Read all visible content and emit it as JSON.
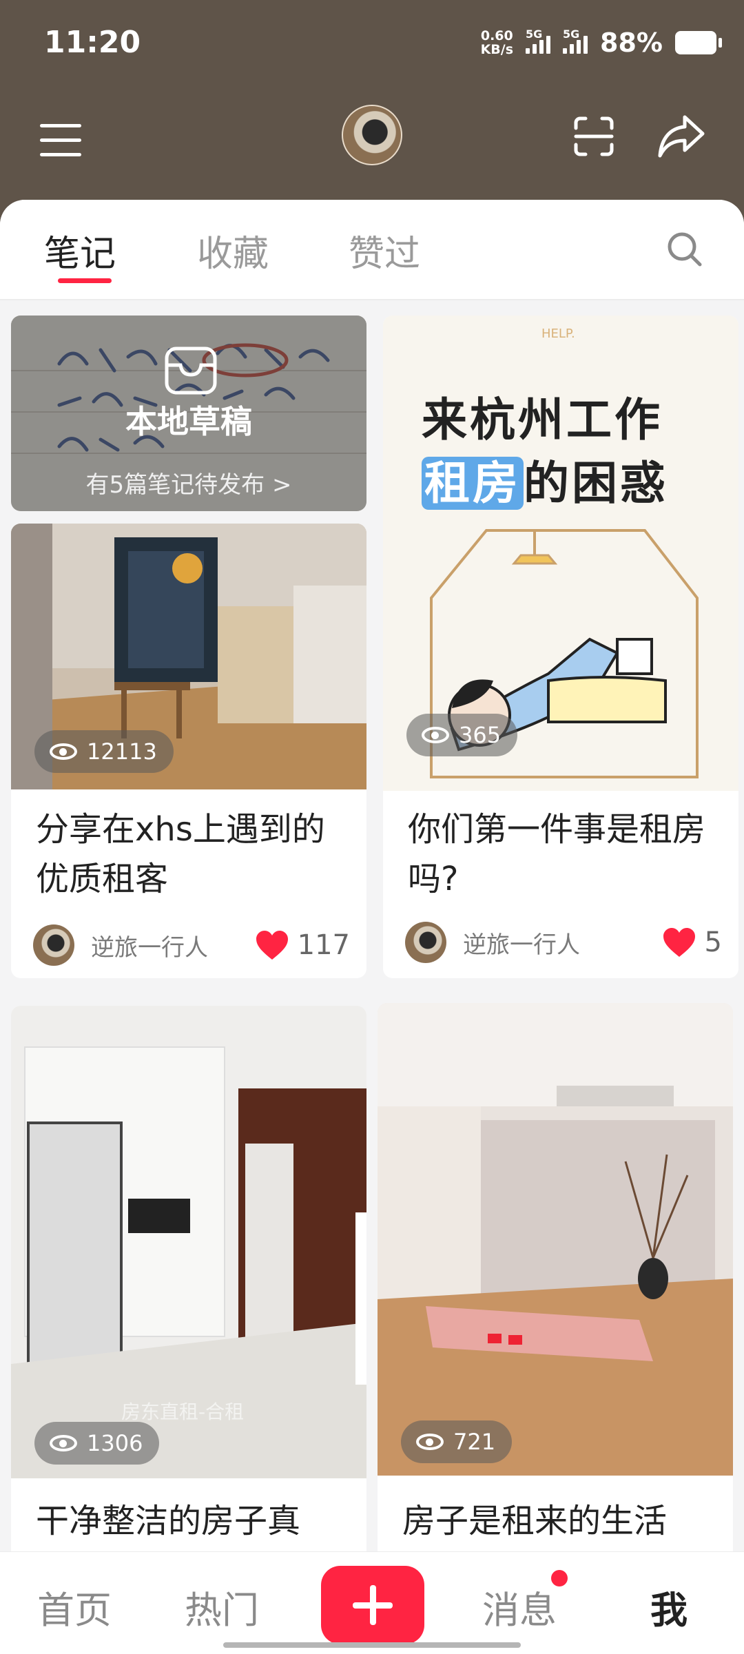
{
  "status_bar": {
    "time": "11:20",
    "net_speed_value": "0.60",
    "net_speed_unit": "KB/s",
    "sim1_label": "5G",
    "sim2_label": "5G",
    "battery": "88%"
  },
  "tabs": [
    {
      "label": "笔记",
      "active": true
    },
    {
      "label": "收藏",
      "active": false
    },
    {
      "label": "赞过",
      "active": false
    }
  ],
  "draft": {
    "title": "本地草稿",
    "subtitle": "有5篇笔记待发布 >"
  },
  "notes": [
    {
      "title": "分享在xhs上遇到的优质租客",
      "views": "12113",
      "author": "逆旅一行人",
      "likes": "117"
    },
    {
      "title": "你们第一件事是租房吗?",
      "views": "365",
      "author": "逆旅一行人",
      "likes": "5",
      "cover_line1": "来杭州工作",
      "cover_hl": "租房",
      "cover_rest": "的困惑",
      "cover_tag": "HELP."
    },
    {
      "title": "干净整洁的房子真",
      "views": "1306",
      "watermark": "房东直租-合租"
    },
    {
      "title": "房子是租来的生活",
      "views": "721"
    }
  ],
  "bottom_nav": {
    "home": "首页",
    "hot": "热门",
    "messages": "消息",
    "me": "我"
  },
  "colors": {
    "accent": "#ff2442",
    "header_bg": "#5f5449"
  }
}
